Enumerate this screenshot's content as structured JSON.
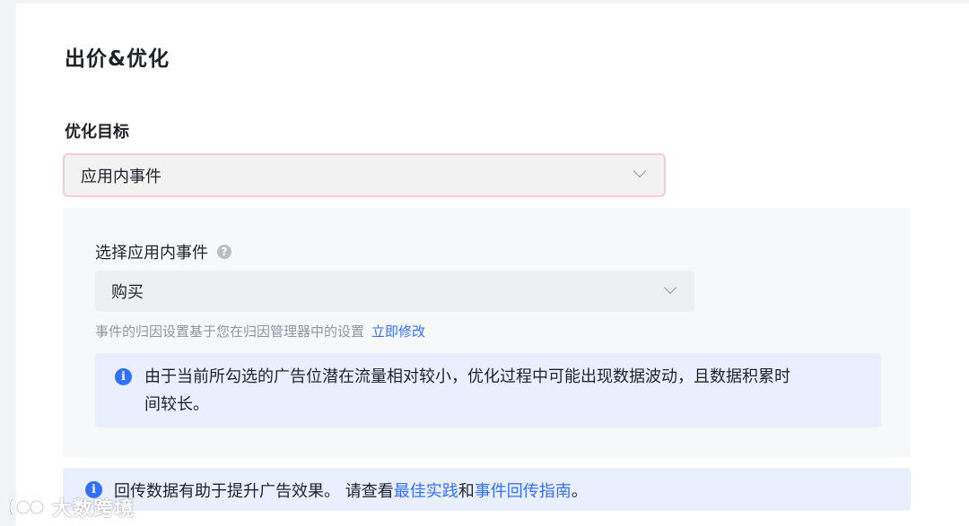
{
  "section": {
    "title": "出价&优化"
  },
  "optimization_goal": {
    "label": "优化目标",
    "selected": "应用内事件"
  },
  "in_app_event": {
    "label": "选择应用内事件",
    "help_icon": "question-circle-icon",
    "selected": "购买",
    "hint": "事件的归因设置基于您在归因管理器中的设置",
    "hint_link": "立即修改"
  },
  "notice": {
    "icon": "info-circle-icon",
    "line1": "由于当前所勾选的广告位潜在流量相对较小，优化过程中可能出现数据波动，且数据积累时",
    "line2": "间较长。"
  },
  "tip": {
    "icon": "info-circle-icon",
    "prefix": "回传数据有助于提升广告效果。 请查看",
    "link1": "最佳实践",
    "middle": "和",
    "link2": "事件回传指南",
    "suffix": "。"
  },
  "watermark": {
    "text": "大数跨境"
  },
  "colors": {
    "accent": "#3370ff",
    "info_bg": "#e9efff",
    "select_border": "#f7c9d0"
  }
}
